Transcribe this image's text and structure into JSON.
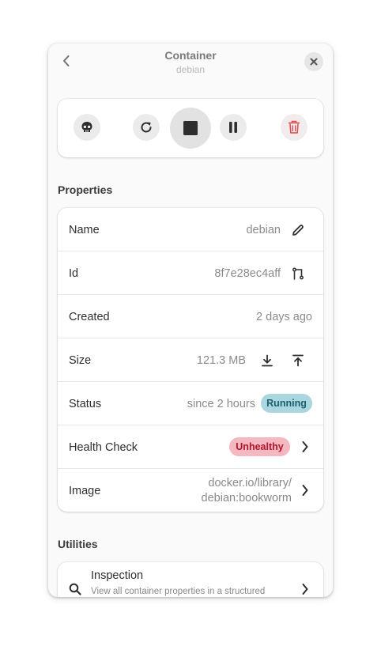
{
  "header": {
    "title": "Container",
    "subtitle": "debian"
  },
  "sections": {
    "properties": "Properties",
    "utilities": "Utilities"
  },
  "properties": {
    "name": {
      "label": "Name",
      "value": "debian"
    },
    "id": {
      "label": "Id",
      "value": "8f7e28ec4aff"
    },
    "created": {
      "label": "Created",
      "value": "2 days ago"
    },
    "size": {
      "label": "Size",
      "value": "121.3 MB"
    },
    "status": {
      "label": "Status",
      "since": "since 2 hours",
      "badge": "Running"
    },
    "health": {
      "label": "Health Check",
      "badge": "Unhealthy"
    },
    "image": {
      "label": "Image",
      "line1": "docker.io/library/",
      "line2": "debian:bookworm"
    }
  },
  "utilities": {
    "inspection": {
      "title": "Inspection",
      "description": "View all container properties in a structured"
    }
  },
  "icons": [
    "go-back-icon",
    "close-icon",
    "skull-icon",
    "restart-icon",
    "stop-icon",
    "pause-icon",
    "trash-icon",
    "pencil-icon",
    "copy-icon",
    "download-icon",
    "upload-icon",
    "chevron-right-icon",
    "search-icon"
  ],
  "colors": {
    "running_bg": "#a9d6df",
    "running_fg": "#195f6d",
    "unhealthy_bg": "#f4b9c0",
    "unhealthy_fg": "#b0152d",
    "delete_red": "#e0474e"
  }
}
